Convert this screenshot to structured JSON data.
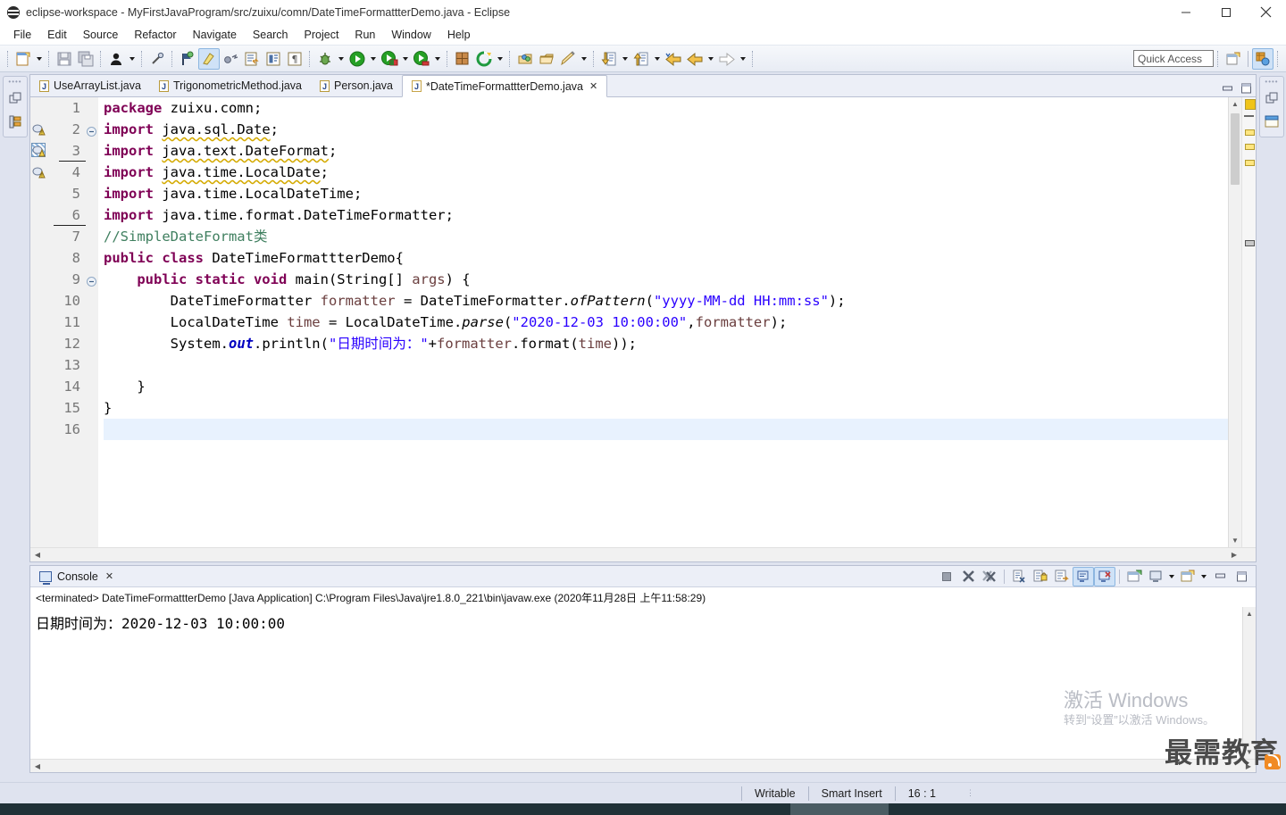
{
  "window": {
    "title": "eclipse-workspace - MyFirstJavaProgram/src/zuixu/comn/DateTimeFormattterDemo.java - Eclipse",
    "app_icon": "eclipse-icon",
    "minimize": "minimize-button",
    "maximize": "maximize-button",
    "close": "close-button"
  },
  "menubar": {
    "items": [
      {
        "label": "File"
      },
      {
        "label": "Edit"
      },
      {
        "label": "Source"
      },
      {
        "label": "Refactor"
      },
      {
        "label": "Navigate"
      },
      {
        "label": "Search"
      },
      {
        "label": "Project"
      },
      {
        "label": "Run"
      },
      {
        "label": "Window"
      },
      {
        "label": "Help"
      }
    ]
  },
  "toolbar": {
    "groups": [
      [
        "new-wizard-icon",
        "dropdown"
      ],
      [
        "save-icon",
        "save-all-icon"
      ],
      [
        "person-icon",
        "dropdown"
      ],
      [
        "skip-breakpoints-icon"
      ],
      [
        "next-annotation-icon",
        "toggle-mark-occurrences-icon",
        "last-edit-location-icon",
        "open-task-icon",
        "open-type-icon",
        "show-whitespace-icon"
      ],
      [
        "debug-icon",
        "dropdown",
        "run-icon",
        "dropdown",
        "run-coverage-icon",
        "dropdown",
        "external-tools-icon",
        "dropdown"
      ],
      [
        "new-java-project-icon",
        "new-package-icon",
        "dropdown"
      ],
      [
        "open-type-hierarchy-icon",
        "open-task-repository-icon",
        "search-icon",
        "dropdown"
      ],
      [
        "next-edit-icon",
        "dropdown",
        "previous-edit-icon",
        "dropdown",
        "back-icon",
        "forward-icon",
        "dropdown",
        "next-icon",
        "dropdown"
      ]
    ],
    "quick_access_placeholder": "Quick Access",
    "perspective_new_icon": "open-perspective-icon",
    "perspective_java_icon": "java-perspective-icon"
  },
  "left_rail": {
    "restore_icon": "restore-icon",
    "package_explorer_icon": "package-explorer-icon"
  },
  "right_rail": {
    "restore_icon": "restore-icon",
    "outline_icon": "outline-view-icon"
  },
  "editor": {
    "tabs": [
      {
        "label": "UseArrayList.java",
        "active": false,
        "dirty": false
      },
      {
        "label": "TrigonometricMethod.java",
        "active": false,
        "dirty": false
      },
      {
        "label": "Person.java",
        "active": false,
        "dirty": false
      },
      {
        "label": "*DateTimeFormattterDemo.java",
        "active": true,
        "dirty": true,
        "close": "close-tab-icon"
      }
    ],
    "minimize_icon": "minimize-part-icon",
    "maximize_icon": "maximize-part-icon",
    "lines": [
      {
        "no": "1",
        "marker": "",
        "fold": "",
        "text": "package zuixu.comn;"
      },
      {
        "no": "2",
        "marker": "warning",
        "fold": "minus",
        "text": "import java.sql.Date;"
      },
      {
        "no": "3",
        "marker": "warning",
        "fold": "",
        "text": "import java.text.DateFormat;"
      },
      {
        "no": "4",
        "marker": "warning",
        "fold": "",
        "text": "import java.time.LocalDate;"
      },
      {
        "no": "5",
        "marker": "",
        "fold": "",
        "text": "import java.time.LocalDateTime;"
      },
      {
        "no": "6",
        "marker": "",
        "fold": "",
        "text": "import java.time.format.DateTimeFormatter;"
      },
      {
        "no": "7",
        "marker": "",
        "fold": "",
        "text": "//SimpleDateFormat类"
      },
      {
        "no": "8",
        "marker": "",
        "fold": "",
        "text": "public class DateTimeFormattterDemo{"
      },
      {
        "no": "9",
        "marker": "",
        "fold": "minus",
        "text": "    public static void main(String[] args) {"
      },
      {
        "no": "10",
        "marker": "",
        "fold": "",
        "text": "        DateTimeFormatter formatter = DateTimeFormatter.ofPattern(\"yyyy-MM-dd HH:mm:ss\");"
      },
      {
        "no": "11",
        "marker": "",
        "fold": "",
        "text": "        LocalDateTime time = LocalDateTime.parse(\"2020-12-03 10:00:00\",formatter);"
      },
      {
        "no": "12",
        "marker": "",
        "fold": "",
        "text": "        System.out.println(\"日期时间为：\"+formatter.format(time));"
      },
      {
        "no": "13",
        "marker": "",
        "fold": "",
        "text": ""
      },
      {
        "no": "14",
        "marker": "",
        "fold": "",
        "text": "    }"
      },
      {
        "no": "15",
        "marker": "",
        "fold": "",
        "text": "}"
      },
      {
        "no": "16",
        "marker": "",
        "fold": "",
        "text": ""
      }
    ]
  },
  "console": {
    "tab_label": "Console",
    "tab_icon": "console-icon",
    "close_icon": "close-tab-icon",
    "header": "<terminated> DateTimeFormattterDemo [Java Application] C:\\Program Files\\Java\\jre1.8.0_221\\bin\\javaw.exe (2020年11月28日 上午11:58:29)",
    "output": "日期时间为：2020-12-03 10:00:00",
    "tools": [
      "terminate-icon",
      "remove-launch-icon",
      "remove-all-terminated-icon",
      "clear-console-icon",
      "scroll-lock-icon",
      "word-wrap-icon",
      "show-console-on-output-icon",
      "show-console-on-error-icon",
      "pin-console-icon",
      "display-selected-console-icon",
      "dropdown",
      "open-console-icon",
      "dropdown",
      "minimize-part-icon",
      "maximize-part-icon"
    ]
  },
  "statusbar": {
    "writable": "Writable",
    "insert_mode": "Smart Insert",
    "position": "16 : 1"
  },
  "watermark": {
    "windows_line1": "激活 Windows",
    "windows_line2": "转到“设置”以激活 Windows。",
    "brand": "最需教育",
    "brand_icon": "rss-icon"
  },
  "colors": {
    "keyword": "#7f0055",
    "string": "#2a00ff",
    "comment": "#3f7f5f",
    "field": "#0000c0",
    "local": "#6a3e3e",
    "selection": "#cfe2f7",
    "chrome": "#dfe3ef"
  }
}
